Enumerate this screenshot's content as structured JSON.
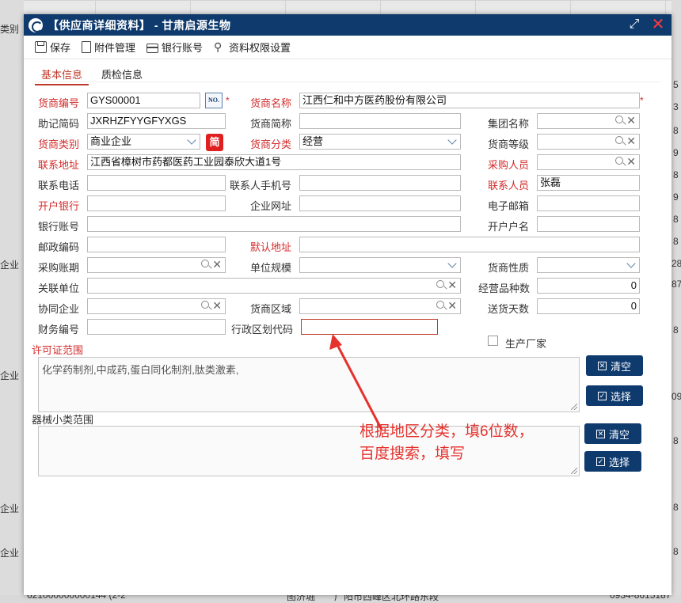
{
  "background": {
    "left_texts": [
      "类别",
      "企业",
      "企业",
      "企业",
      "企业"
    ],
    "right_texts": [
      "5",
      "3",
      "8",
      "9",
      "8",
      "9",
      "8",
      "8",
      "28",
      "87",
      "8",
      "09",
      "8",
      "8",
      "8"
    ],
    "bottom_row": [
      "621000000000144 (2-2",
      "图济堀",
      "广阳市西峰区北环路东段",
      "0934-8615187"
    ]
  },
  "window": {
    "title": "【供应商详细资料】 - 甘肃启源生物",
    "maximize_icon": "maximize-icon",
    "close_icon": "close-icon"
  },
  "toolbar": {
    "save": "保存",
    "attachments": "附件管理",
    "bank_account": "银行账号",
    "permissions": "资料权限设置"
  },
  "tabs": [
    {
      "label": "基本信息",
      "active": true
    },
    {
      "label": "质检信息",
      "active": false
    }
  ],
  "form": {
    "supplier_code": {
      "label": "货商编号",
      "value": "GYS00001",
      "no_button": "NO."
    },
    "supplier_name": {
      "label": "货商名称",
      "value": "江西仁和中方医药股份有限公司"
    },
    "mnemonic": {
      "label": "助记简码",
      "value": "JXRHZFYYGFYXGS"
    },
    "short_name": {
      "label": "货商简称",
      "value": ""
    },
    "group_name": {
      "label": "集团名称",
      "value": ""
    },
    "supplier_type": {
      "label": "货商类别",
      "value": "商业企业",
      "button": "简"
    },
    "supplier_category": {
      "label": "货商分类",
      "value": "经营"
    },
    "supplier_grade": {
      "label": "货商等级",
      "value": ""
    },
    "address": {
      "label": "联系地址",
      "value": "江西省樟树市药都医药工业园泰欣大道1号"
    },
    "buyer": {
      "label": "采购人员",
      "value": ""
    },
    "phone": {
      "label": "联系电话",
      "value": ""
    },
    "mobile": {
      "label": "联系人手机号",
      "value": ""
    },
    "contact": {
      "label": "联系人员",
      "value": "张磊"
    },
    "bank": {
      "label": "开户银行",
      "value": ""
    },
    "website": {
      "label": "企业网址",
      "value": ""
    },
    "email": {
      "label": "电子邮箱",
      "value": ""
    },
    "bank_account": {
      "label": "银行账号",
      "value": ""
    },
    "account_name": {
      "label": "开户户名",
      "value": ""
    },
    "postcode": {
      "label": "邮政编码",
      "value": ""
    },
    "default_address": {
      "label": "默认地址",
      "value": ""
    },
    "purchase_period": {
      "label": "采购账期",
      "value": ""
    },
    "unit_scale": {
      "label": "单位规模",
      "value": ""
    },
    "supplier_nature": {
      "label": "货商性质",
      "value": ""
    },
    "related_unit": {
      "label": "关联单位",
      "value": ""
    },
    "product_count": {
      "label": "经营品种数",
      "value": "0"
    },
    "partner": {
      "label": "协同企业",
      "value": ""
    },
    "region": {
      "label": "货商区域",
      "value": ""
    },
    "delivery_days": {
      "label": "送货天数",
      "value": "0"
    },
    "finance_code": {
      "label": "财务编号",
      "value": ""
    },
    "admin_code": {
      "label": "行政区划代码",
      "value": ""
    },
    "manufacturer": {
      "label": "生产厂家",
      "checked": false
    }
  },
  "license_scope": {
    "label": "许可证范围",
    "value": "化学药制剂,中成药,蛋白同化制剂,肽类激素,",
    "clear": "清空",
    "select": "选择"
  },
  "device_scope": {
    "label": "器械小类范围",
    "value": "",
    "clear": "清空",
    "select": "选择"
  },
  "annotation": {
    "line1": "根据地区分类，填6位数，",
    "line2": "百度搜索，填写",
    "color": "#e5322d"
  }
}
